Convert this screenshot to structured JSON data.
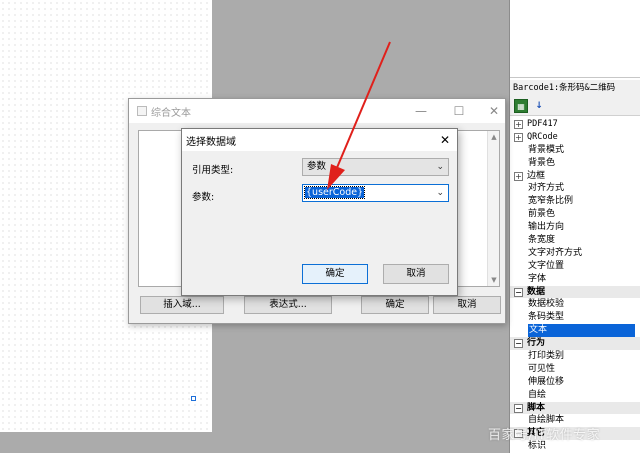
{
  "property_panel": {
    "header": "Barcode1:条形码&二维码",
    "items": [
      {
        "label": "PDF417",
        "kind": "expandable"
      },
      {
        "label": "QRCode",
        "kind": "expandable"
      },
      {
        "label": "背景模式",
        "kind": "child"
      },
      {
        "label": "背景色",
        "kind": "child"
      },
      {
        "label": "边框",
        "kind": "expandable"
      },
      {
        "label": "对齐方式",
        "kind": "child"
      },
      {
        "label": "宽窄条比例",
        "kind": "child"
      },
      {
        "label": "前景色",
        "kind": "child"
      },
      {
        "label": "输出方向",
        "kind": "child"
      },
      {
        "label": "条宽度",
        "kind": "child"
      },
      {
        "label": "文字对齐方式",
        "kind": "child"
      },
      {
        "label": "文字位置",
        "kind": "child"
      },
      {
        "label": "字体",
        "kind": "child"
      },
      {
        "label": "数据",
        "kind": "category"
      },
      {
        "label": "数据校验",
        "kind": "child"
      },
      {
        "label": "条码类型",
        "kind": "child"
      },
      {
        "label": "文本",
        "kind": "selected"
      },
      {
        "label": "行为",
        "kind": "category"
      },
      {
        "label": "打印类别",
        "kind": "child"
      },
      {
        "label": "可见性",
        "kind": "child"
      },
      {
        "label": "伸展位移",
        "kind": "child"
      },
      {
        "label": "自绘",
        "kind": "child"
      },
      {
        "label": "脚本",
        "kind": "category"
      },
      {
        "label": "自绘脚本",
        "kind": "child"
      },
      {
        "label": "其它",
        "kind": "category"
      },
      {
        "label": "标识",
        "kind": "child"
      }
    ]
  },
  "back_window": {
    "title": "综合文本",
    "insert_field_label": "插入域...",
    "expression_label": "表达式...",
    "ok_label": "确定",
    "cancel_label": "取消"
  },
  "front_dialog": {
    "title": "选择数据域",
    "ref_type_label": "引用类型:",
    "ref_type_value": "参数",
    "param_label": "参数:",
    "param_value": "{userCode}",
    "ok_label": "确定",
    "cancel_label": "取消"
  },
  "watermark": "百家号/IT软件专家",
  "colors": {
    "selection": "#0a64d8",
    "annotation_arrow": "#e0201b",
    "workspace": "#ababab"
  }
}
